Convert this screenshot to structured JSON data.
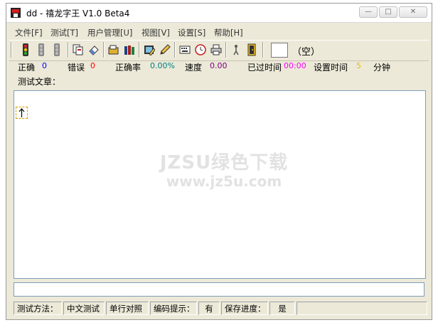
{
  "window": {
    "title": "dd - 禧龙字王 V1.0 Beta4",
    "controls": {
      "minimize": "—",
      "maximize": "□",
      "close": "✕"
    }
  },
  "menu": [
    "文件[F]",
    "测试[T]",
    "用户管理[U]",
    "视图[V]",
    "设置[S]",
    "帮助[H]"
  ],
  "toolbar": {
    "icons": [
      "traffic-light-icon",
      "traffic-light-disabled-icon",
      "traffic-light-disabled-icon",
      "copy-document-icon",
      "eraser-icon",
      "folder-open-icon",
      "books-icon",
      "edit-image-icon",
      "pencil-icon",
      "keyboard-icon",
      "clock-icon",
      "printer-icon",
      "figure-icon",
      "exit-door-icon"
    ],
    "empty_label": "（空）"
  },
  "stats": {
    "correct_label": "正确",
    "correct_value": "0",
    "error_label": "错误",
    "error_value": "0",
    "accuracy_label": "正确率",
    "accuracy_value": "0.00%",
    "speed_label": "速度",
    "speed_value": "0.00",
    "elapsed_label": "已过时间",
    "elapsed_value": "00:00",
    "set_time_label": "设置时间",
    "set_time_value": "5",
    "minutes_label": "分钟"
  },
  "article_label": "测试文章：",
  "main": {
    "cursor_char": "↑",
    "watermark_line1": "JZSU绿色下载",
    "watermark_line2": "www.jz5u.com"
  },
  "status": {
    "method_label": "测试方法：",
    "method_value": "中文测试",
    "mode_value": "单行对照",
    "hint_label": "编码提示：",
    "hint_value": "有",
    "save_label": "保存进度：",
    "save_value": "是"
  },
  "colors": {
    "correct": "#0000ff",
    "error": "#ff0000",
    "accuracy": "#008080",
    "speed": "#800080",
    "elapsed": "#ff00ff",
    "set_time": "#e0c000"
  }
}
